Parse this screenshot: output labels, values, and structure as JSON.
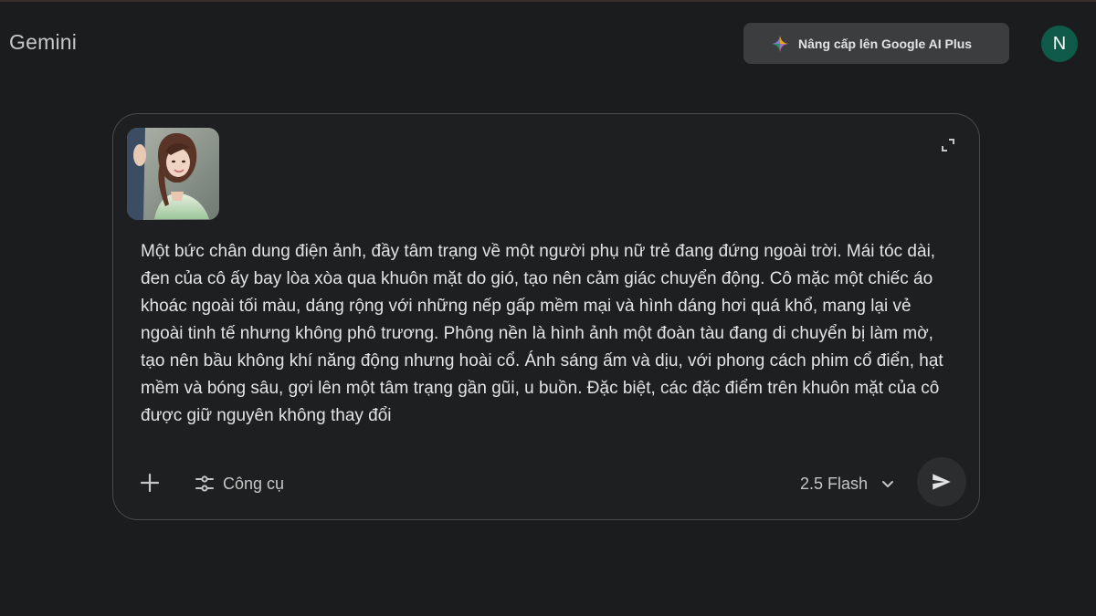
{
  "app": {
    "name": "Gemini"
  },
  "header": {
    "upgrade_label": "Nâng cấp lên Google AI Plus",
    "avatar_initial": "N"
  },
  "composer": {
    "prompt_text": "Một bức chân dung điện ảnh, đầy tâm trạng về một người phụ nữ trẻ đang đứng ngoài trời. Mái tóc dài, đen của cô ấy bay lòa xòa qua khuôn mặt do gió, tạo nên cảm giác chuyển động. Cô mặc một chiếc áo khoác ngoài tối màu, dáng rộng với những nếp gấp mềm mại và hình dáng hơi quá khổ, mang lại vẻ ngoài tinh tế nhưng không phô trương. Phông nền là hình ảnh một đoàn tàu đang di chuyển bị làm mờ, tạo nên bầu không khí năng động nhưng hoài cổ. Ánh sáng ấm và dịu, với phong cách phim cổ điển, hạt mềm và bóng sâu, gợi lên một tâm trạng gần gũi, u buồn. Đặc biệt, các đặc điểm trên khuôn mặt của cô được giữ nguyên không thay đổi",
    "tools_label": "Công cụ",
    "model_label": "2.5 Flash"
  },
  "icons": {
    "upgrade": "sparkle-icon",
    "expand": "expand-icon",
    "add": "plus-icon",
    "tools": "tune-icon",
    "model_dropdown": "chevron-down-icon",
    "send": "send-icon"
  },
  "colors": {
    "background": "#1b1c1d",
    "composer": "#1e1f20",
    "avatar": "#0f5a48",
    "upgrade_button": "#3c3d3f"
  }
}
